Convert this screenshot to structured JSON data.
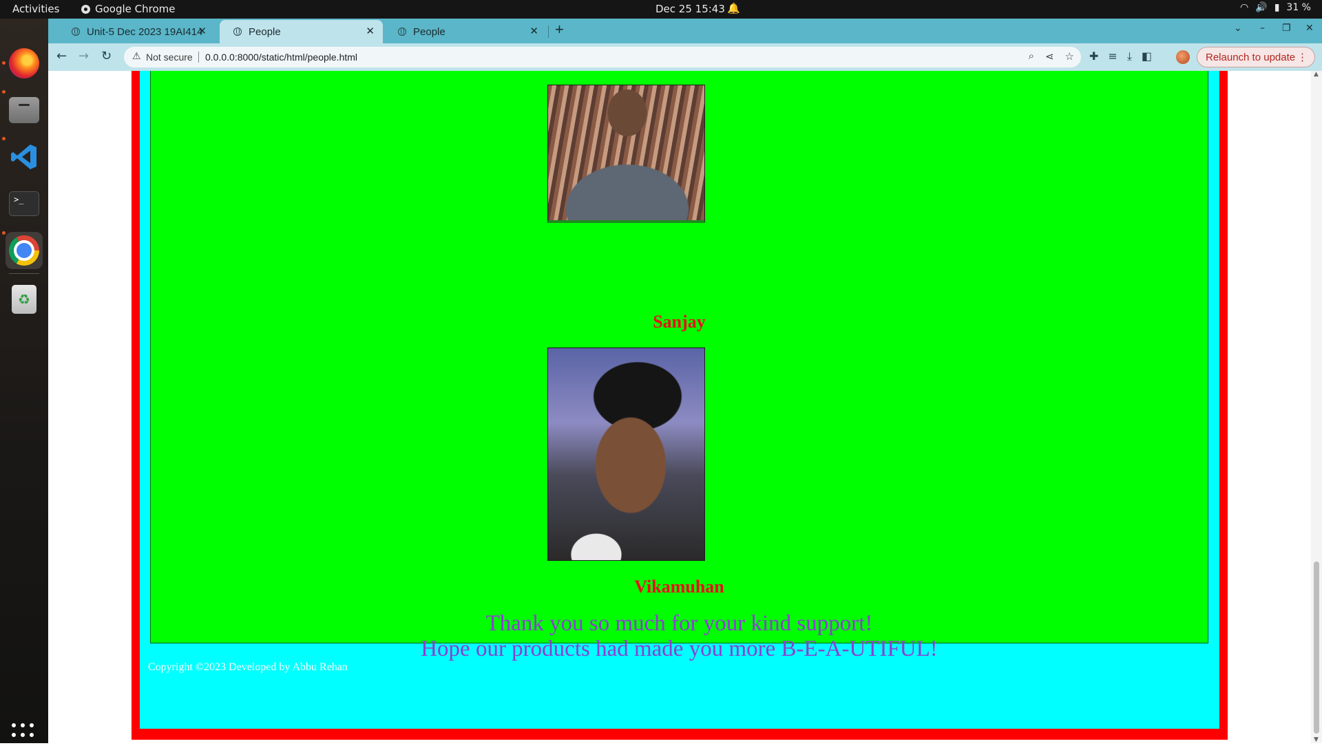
{
  "system": {
    "activities": "Activities",
    "app_name": "Google Chrome",
    "clock": "Dec 25  15:43",
    "battery": "31 %"
  },
  "dock": {
    "items": [
      "Firefox",
      "Files",
      "Visual Studio Code",
      "Terminal",
      "Google Chrome",
      "Trash"
    ],
    "terminal_glyph": ">_"
  },
  "browser": {
    "tabs": [
      {
        "title": "Unit-5 Dec 2023 19AI414"
      },
      {
        "title": "People"
      },
      {
        "title": "People"
      }
    ],
    "security_label": "Not secure",
    "url": "0.0.0.0:8000/static/html/people.html",
    "relaunch_label": "Relaunch to update"
  },
  "page": {
    "people": [
      {
        "name": "Sanjay"
      },
      {
        "name": "Vikamuhan"
      }
    ],
    "thanks_line1": "Thank you so much for your kind support!",
    "thanks_line2": "Hope our products had made you more B-E-A-UTIFUL!",
    "copyright": "Copyright ©2023 Developed by Abbu Rehan",
    "colors": {
      "frame": "#ff0000",
      "footer_bg": "#00ffff",
      "content_bg": "#00ff00",
      "name_text": "#e8101a",
      "thanks_text": "#8b3fd1"
    }
  }
}
